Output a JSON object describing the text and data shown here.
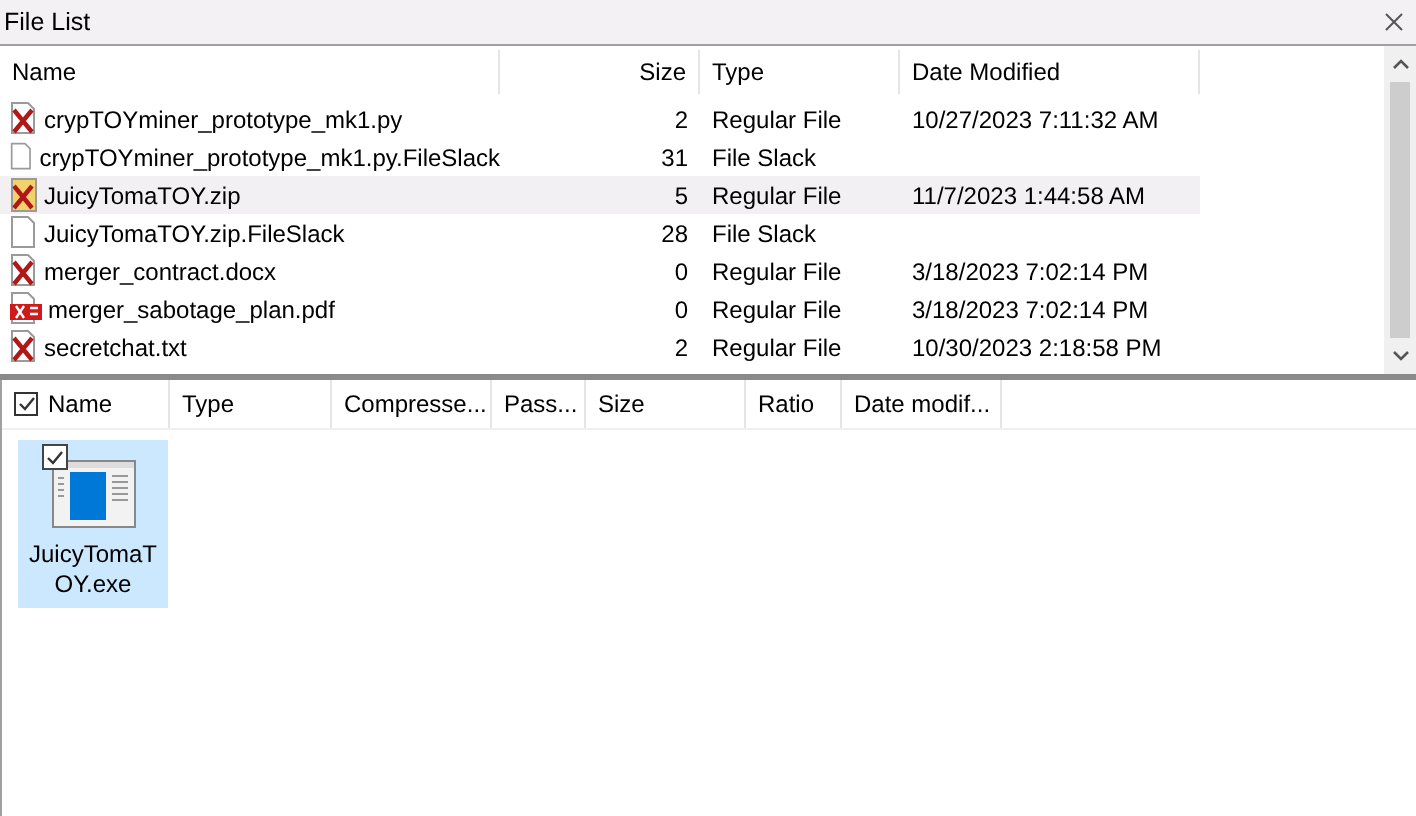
{
  "window": {
    "title": "File List"
  },
  "file_list": {
    "columns": [
      "Name",
      "Size",
      "Type",
      "Date Modified"
    ],
    "rows": [
      {
        "kind": "deleted",
        "name": "crypTOYminer_prototype_mk1.py",
        "size": "2",
        "type": "Regular File",
        "date": "10/27/2023 7:11:32 AM",
        "selected": false
      },
      {
        "kind": "slack",
        "name": "crypTOYminer_prototype_mk1.py.FileSlack",
        "size": "31",
        "type": "File Slack",
        "selected": false
      },
      {
        "kind": "archive",
        "name": "JuicyTomaTOY.zip",
        "size": "5",
        "type": "Regular File",
        "date": "11/7/2023 1:44:58 AM",
        "selected": true
      },
      {
        "kind": "slack",
        "name": "JuicyTomaTOY.zip.FileSlack",
        "size": "28",
        "type": "File Slack",
        "selected": false
      },
      {
        "kind": "deleted",
        "name": "merger_contract.docx",
        "size": "0",
        "type": "Regular File",
        "date": "3/18/2023 7:02:14 PM",
        "selected": false
      },
      {
        "kind": "pdf",
        "name": "merger_sabotage_plan.pdf",
        "size": "0",
        "type": "Regular File",
        "date": "3/18/2023 7:02:14 PM",
        "selected": false
      },
      {
        "kind": "deleted",
        "name": "secretchat.txt",
        "size": "2",
        "type": "Regular File",
        "date": "10/30/2023 2:18:58 PM",
        "selected": false
      }
    ]
  },
  "archive_view": {
    "select_all_checked": true,
    "columns": [
      "Name",
      "Type",
      "Compresse...",
      "Pass...",
      "Size",
      "Ratio",
      "Date modif..."
    ],
    "items": [
      {
        "name": "JuicyTomaTOY.exe",
        "checked": true,
        "selected": true
      }
    ]
  }
}
